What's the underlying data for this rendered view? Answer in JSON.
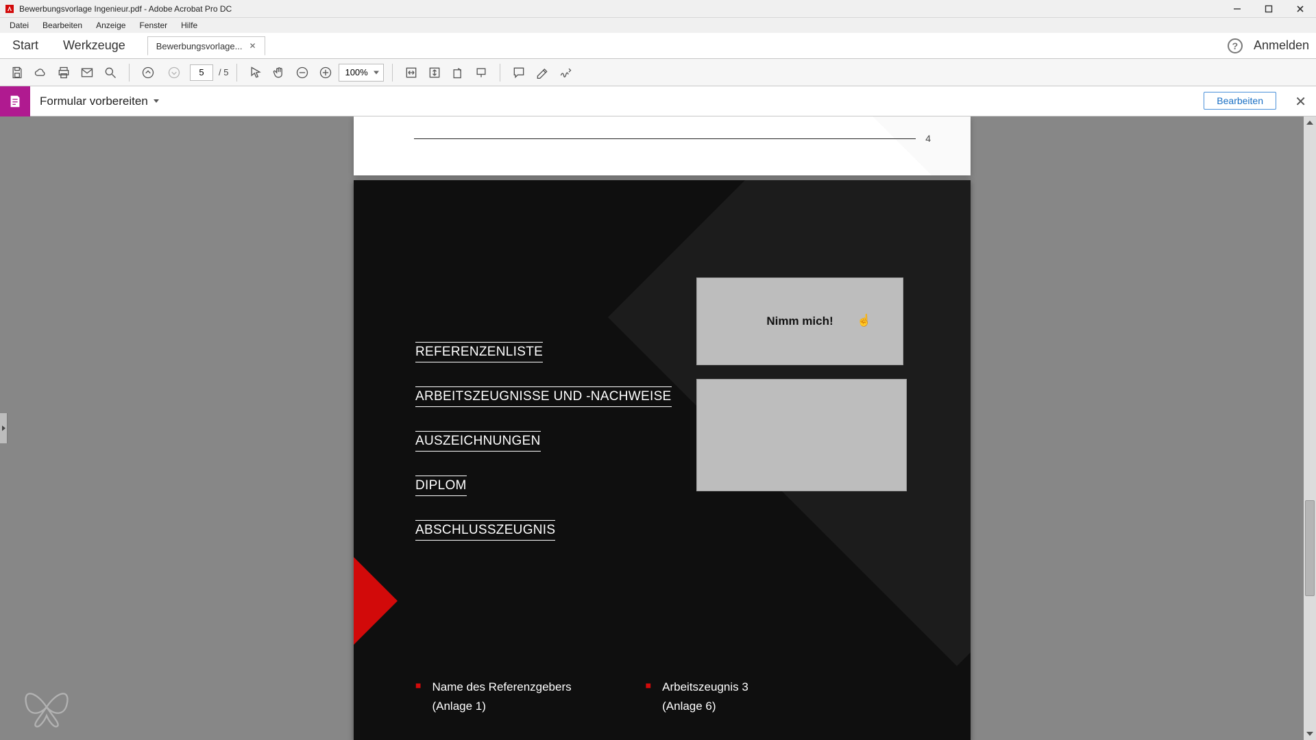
{
  "window": {
    "title": "Bewerbungsvorlage Ingenieur.pdf - Adobe Acrobat Pro DC"
  },
  "menu": {
    "items": [
      "Datei",
      "Bearbeiten",
      "Anzeige",
      "Fenster",
      "Hilfe"
    ]
  },
  "tabs": {
    "start": "Start",
    "tools": "Werkzeuge",
    "doc_tab_label": "Bewerbungsvorlage...",
    "help_glyph": "?",
    "signin": "Anmelden"
  },
  "toolbar": {
    "page_current": "5",
    "page_total": "/ 5",
    "zoom": "100%",
    "icons": {
      "save": "save-icon",
      "cloud": "cloud-icon",
      "print": "print-icon",
      "mail": "mail-icon",
      "search": "search-icon",
      "page_up": "page-up-icon",
      "page_down": "page-down-icon",
      "zoom_out": "zoom-out-icon",
      "zoom_in": "zoom-in-icon",
      "arrow": "arrow-tool-icon",
      "hand": "hand-tool-icon",
      "fit_width": "fit-width-icon",
      "fit_page": "fit-page-icon",
      "rotate": "rotate-icon",
      "tag": "tag-icon",
      "comment": "comment-icon",
      "highlight": "highlight-icon",
      "sign": "sign-icon"
    }
  },
  "tool_strip": {
    "name": "Formular vorbereiten",
    "edit_button": "Bearbeiten",
    "close_glyph": "✕"
  },
  "prev_page": {
    "number": "4"
  },
  "doc": {
    "headings": [
      "REFERENZENLISTE",
      "ARBEITSZEUGNISSE UND -NACHWEISE",
      "AUSZEICHNUNGEN",
      "DIPLOM",
      "ABSCHLUSSZEUGNIS"
    ],
    "callout_box": "Nimm mich!",
    "col1_line1": "Name des Referenzgebers",
    "col1_line2": "(Anlage 1)",
    "col2_line1": "Arbeitszeugnis 3",
    "col2_line2": "(Anlage 6)"
  }
}
